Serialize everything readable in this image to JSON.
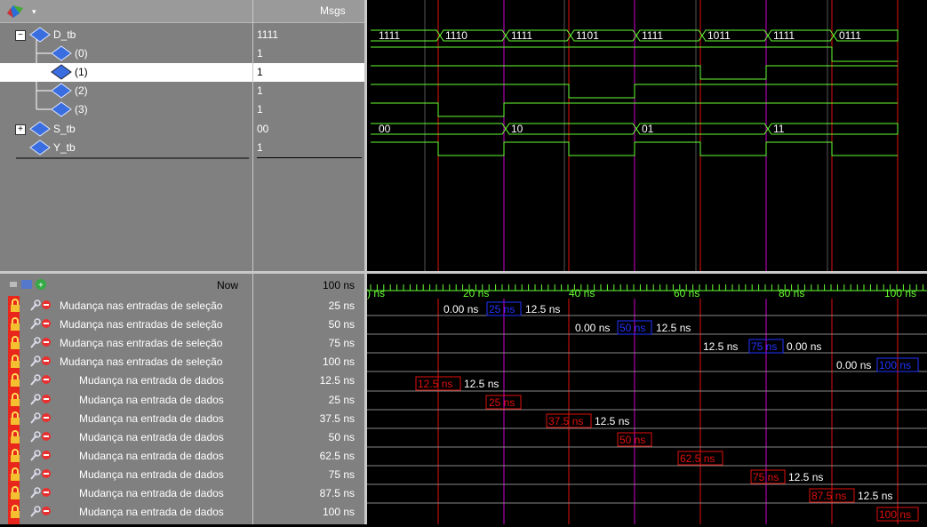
{
  "header": {
    "msgs": "Msgs"
  },
  "signals": [
    {
      "name": "D_tb",
      "value": "1111"
    },
    {
      "name": "(0)",
      "value": "1"
    },
    {
      "name": "(1)",
      "value": "1"
    },
    {
      "name": "(2)",
      "value": "1"
    },
    {
      "name": "(3)",
      "value": "1"
    },
    {
      "name": "S_tb",
      "value": "00"
    },
    {
      "name": "Y_tb",
      "value": "1"
    }
  ],
  "d_bus_values": [
    "1111",
    "1110",
    "1111",
    "1101",
    "1111",
    "1011",
    "1111",
    "0111"
  ],
  "s_bus_values": [
    "00",
    "10",
    "01",
    "11"
  ],
  "now": {
    "label": "Now",
    "value": "100 ns"
  },
  "time_ticks": [
    ") ns",
    "20 ns",
    "40 ns",
    "60 ns",
    "80 ns",
    "100 ns"
  ],
  "cursors": [
    {
      "name": "Mudança nas entradas de seleção",
      "value": "25 ns"
    },
    {
      "name": "Mudança nas entradas de seleção",
      "value": "50 ns"
    },
    {
      "name": "Mudança nas entradas de seleção",
      "value": "75 ns"
    },
    {
      "name": "Mudança nas entradas de seleção",
      "value": "100 ns"
    },
    {
      "name": "Mudança na entrada de dados",
      "value": "12.5 ns"
    },
    {
      "name": "Mudança na entrada de dados",
      "value": "25 ns"
    },
    {
      "name": "Mudança na entrada de dados",
      "value": "37.5 ns"
    },
    {
      "name": "Mudança na entrada de dados",
      "value": "50 ns"
    },
    {
      "name": "Mudança na entrada de dados",
      "value": "62.5 ns"
    },
    {
      "name": "Mudança na entrada de dados",
      "value": "75 ns"
    },
    {
      "name": "Mudança na entrada de dados",
      "value": "87.5 ns"
    },
    {
      "name": "Mudança na entrada de dados",
      "value": "100 ns"
    }
  ],
  "cursor_labels": {
    "sel1_left": "0.00 ns",
    "sel1_tag": "25 ns",
    "sel1_right": "12.5 ns",
    "sel2_left": "0.00 ns",
    "sel2_tag": "50 ns",
    "sel2_right": "12.5 ns",
    "sel3_left": "12.5 ns",
    "sel3_tag": "75 ns",
    "sel3_right": "0.00 ns",
    "sel4_left": "0.00 ns",
    "sel4_tag": "100 ns",
    "dat1_tag": "12.5 ns",
    "dat1_right": "12.5 ns",
    "dat2_tag": "25 ns",
    "dat3_tag": "37.5 ns",
    "dat3_right": "12.5 ns",
    "dat4_tag": "50 ns",
    "dat5_tag": "62.5 ns",
    "dat6_tag": "75 ns",
    "dat6_right": "12.5 ns",
    "dat7_tag": "87.5 ns",
    "dat7_right": "12.5 ns",
    "dat8_tag": "100 ns"
  },
  "colors": {
    "wave": "#66ff33",
    "sel_cursor": "#cc00cc",
    "data_cursor": "#e0100c",
    "blue_tag": "#2233ff",
    "tick": "#66ff33"
  },
  "icons": [
    "wave-window-icon",
    "dropdown-icon",
    "collapse-icon",
    "expand-icon",
    "diamond-icon",
    "lock-icon",
    "wrench-icon",
    "delete-icon",
    "cursor-add-icon"
  ]
}
